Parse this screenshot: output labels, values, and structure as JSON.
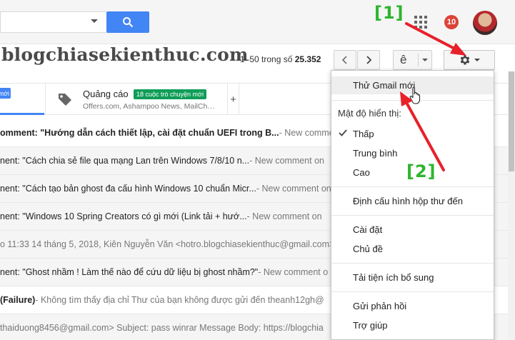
{
  "header": {
    "notification_count": "10"
  },
  "toolbar": {
    "watermark": "blogchiasekienthuc.com",
    "range_prefix": "1–50 trong số",
    "total": "25.352",
    "lang_glyph": "ê"
  },
  "tabs": {
    "primary_badge": "mới",
    "promotions_title": "Quảng cáo",
    "promotions_badge": "18 cuộc trò chuyện mới",
    "promotions_sub": "Offers.com, Ashampoo News, MailCh…",
    "add_label": "+"
  },
  "emails": [
    {
      "subject": "omment: \"Hướng dẫn cách thiết lập, cài đặt chuẩn UEFI trong B...",
      "snippet": " - New comment o",
      "unread": true
    },
    {
      "subject": "nent: \"Cách chia sẻ file qua mạng Lan trên Windows 7/8/10 n...",
      "snippet": " - New comment on",
      "unread": false
    },
    {
      "subject": "nent: \"Cách tạo bản ghost đa cấu hình Windows 10 chuẩn Micr...",
      "snippet": " - New comment on",
      "unread": false
    },
    {
      "subject": "nent: \"Windows 10 Spring Creators có gì mới (Link tải + hướ...",
      "snippet": " - New comment on",
      "unread": false
    },
    {
      "subject": "o 11:33 14 tháng 5, 2018, Kiên Nguyễn Văn <hotro.blogchiasekienthuc@gmail.com>",
      "snippet": "",
      "unread": false
    },
    {
      "subject": "nent: \"Ghost nhầm ! Làm thế nào để cứu dữ liệu bị ghost nhầm?\"",
      "snippet": " - New comment o",
      "unread": false
    },
    {
      "subject": " (Failure)",
      "snippet": " - Không tìm thấy địa chỉ Thư của bạn không được gửi đến theanh12gh@",
      "unread": true
    },
    {
      "subject": "thaiduong8456@gmail.com> Subject: pass winrar Message Body: https://blogchia",
      "snippet": "",
      "unread": false
    }
  ],
  "menu": {
    "try_new": "Thử Gmail mới",
    "density_label": "Mật độ hiển thị:",
    "density_options": [
      "Thấp",
      "Trung bình",
      "Cao"
    ],
    "configure_inbox": "Định cấu hình hộp thư đến",
    "settings": "Cài đặt",
    "themes": "Chủ đề",
    "addons": "Tải tiện ích bổ sung",
    "feedback": "Gửi phản hồi",
    "help": "Trợ giúp"
  },
  "annotations": {
    "label_1": "[1]",
    "label_2": "[2]"
  },
  "colors": {
    "accent_blue": "#4285f4",
    "badge_red": "#db4437",
    "promo_green": "#0f9d58",
    "annotation_red": "#e8202a",
    "annotation_green": "#2db52d"
  }
}
